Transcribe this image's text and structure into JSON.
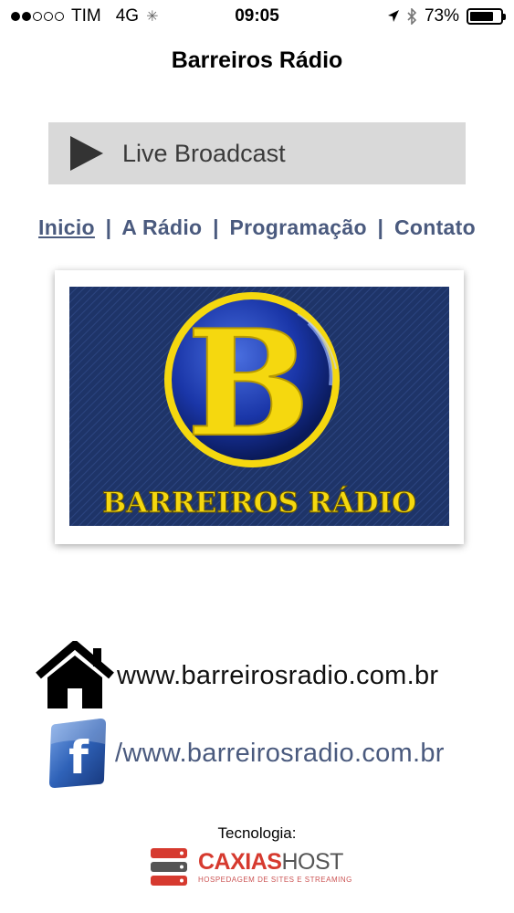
{
  "status_bar": {
    "carrier": "TIM",
    "network": "4G",
    "time": "09:05",
    "battery": "73%",
    "battery_level": 0.73,
    "signal_bars_filled": 2,
    "signal_bars_total": 5
  },
  "app": {
    "title": "Barreiros Rádio"
  },
  "player": {
    "label": "Live Broadcast",
    "icon": "play-icon"
  },
  "nav": {
    "items": [
      {
        "label": "Inicio",
        "active": true
      },
      {
        "label": "A Rádio",
        "active": false
      },
      {
        "label": "Programação",
        "active": false
      },
      {
        "label": "Contato",
        "active": false
      }
    ],
    "separator": "|"
  },
  "logo": {
    "letter": "B",
    "text": "BARREIROS RÁDIO"
  },
  "links": {
    "website": {
      "icon": "home-icon",
      "text": "www.barreirosradio.com.br"
    },
    "facebook": {
      "icon": "facebook-icon",
      "text": "/www.barreirosradio.com.br"
    }
  },
  "footer": {
    "label": "Tecnologia:",
    "brand_part1": "CAXIAS",
    "brand_part2": "HOST",
    "tagline": "HOSPEDAGEM DE SITES E STREAMING"
  },
  "colors": {
    "nav_link": "#4a5a7e",
    "logo_background": "#1e3468",
    "logo_yellow": "#f5d80f",
    "host_red": "#d63a2f"
  }
}
